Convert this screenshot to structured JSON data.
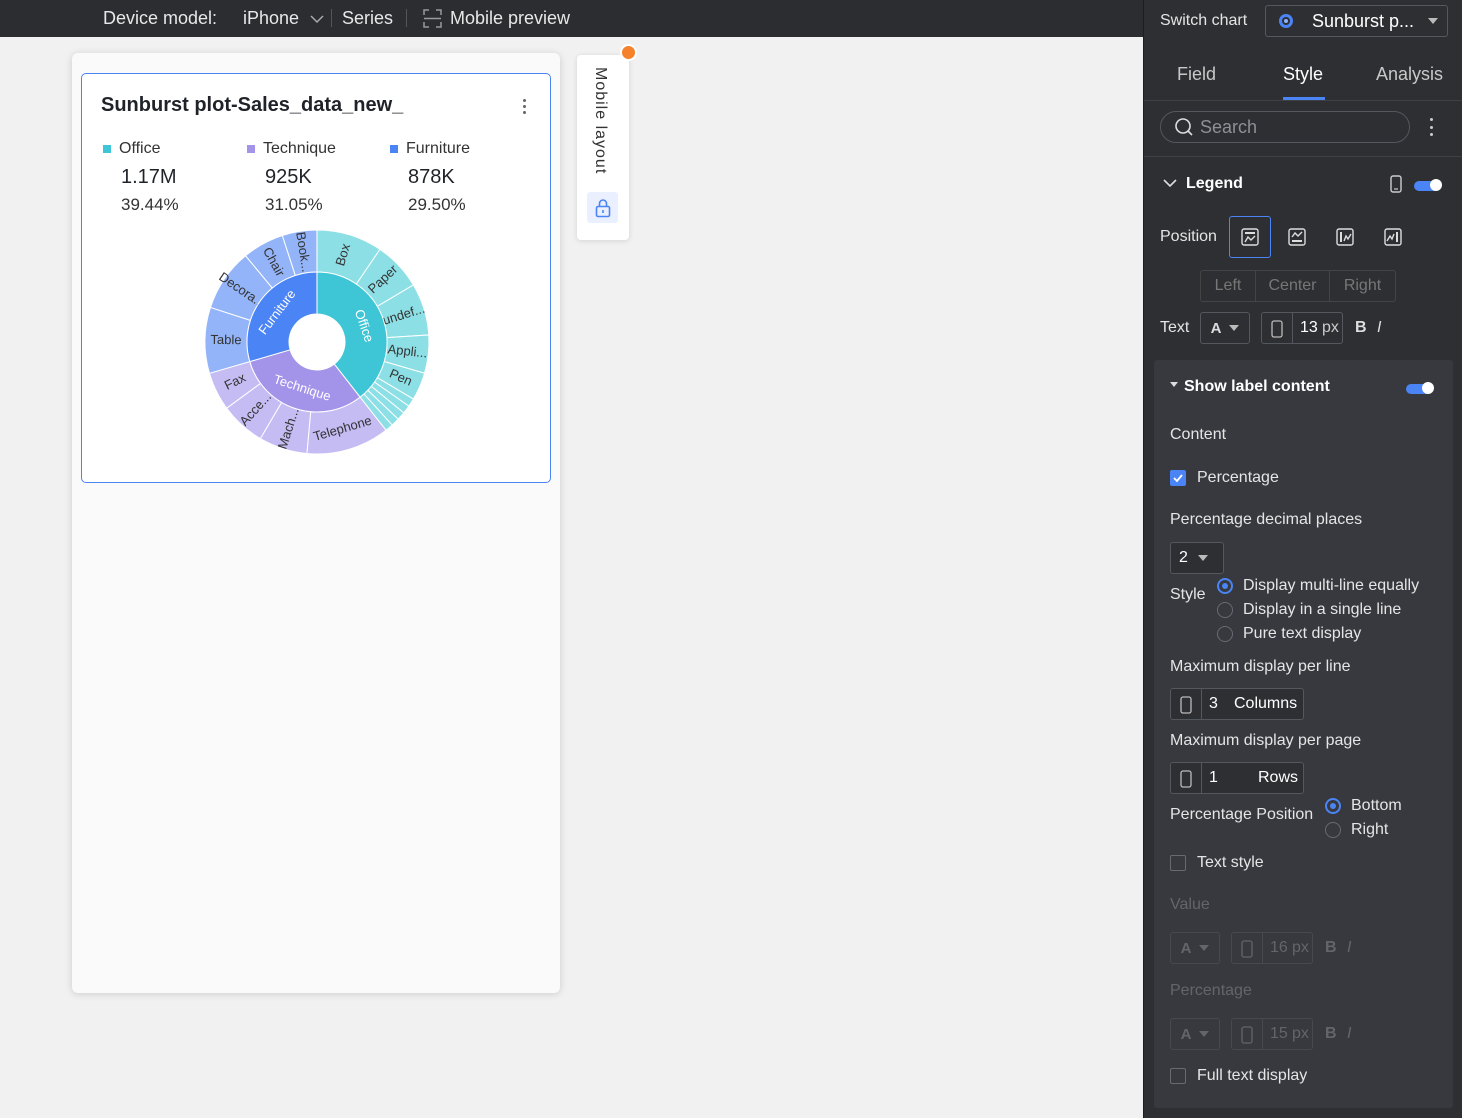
{
  "topbar": {
    "device_label": "Device model:",
    "device_value": "iPhone",
    "series_label": "Series",
    "preview_label": "Mobile preview"
  },
  "card": {
    "title": "Sunburst plot-Sales_data_new_",
    "legend": [
      {
        "name": "Office",
        "value": "1.17M",
        "pct": "39.44%",
        "color": "#3ec6d6"
      },
      {
        "name": "Technique",
        "value": "925K",
        "pct": "31.05%",
        "color": "#a394ea"
      },
      {
        "name": "Furniture",
        "value": "878K",
        "pct": "29.50%",
        "color": "#4a84f5"
      }
    ]
  },
  "chart_data": {
    "type": "sunburst",
    "inner": [
      {
        "name": "Office",
        "share": 0.3944,
        "color": "#3ec6d6"
      },
      {
        "name": "Technique",
        "share": 0.3105,
        "color": "#a394ea"
      },
      {
        "name": "Furniture",
        "share": 0.295,
        "color": "#4a84f5"
      }
    ],
    "outer": [
      {
        "name": "Box",
        "share": 0.095,
        "parent": "Office"
      },
      {
        "name": "Paper",
        "share": 0.07,
        "parent": "Office"
      },
      {
        "name": "undef...",
        "share": 0.075,
        "parent": "Office"
      },
      {
        "name": "Appli...",
        "share": 0.055,
        "parent": "Office"
      },
      {
        "name": "Pen",
        "share": 0.04,
        "parent": "Office"
      },
      {
        "name": "",
        "share": 0.012,
        "parent": "Office"
      },
      {
        "name": "",
        "share": 0.012,
        "parent": "Office"
      },
      {
        "name": "",
        "share": 0.012,
        "parent": "Office"
      },
      {
        "name": "",
        "share": 0.012,
        "parent": "Office"
      },
      {
        "name": "",
        "share": 0.0114,
        "parent": "Office"
      },
      {
        "name": "Telephone",
        "share": 0.12,
        "parent": "Technique"
      },
      {
        "name": "Mach...",
        "share": 0.07,
        "parent": "Technique"
      },
      {
        "name": "Acce...",
        "share": 0.065,
        "parent": "Technique"
      },
      {
        "name": "Fax",
        "share": 0.0555,
        "parent": "Technique"
      },
      {
        "name": "Table",
        "share": 0.095,
        "parent": "Furniture"
      },
      {
        "name": "Decora...",
        "share": 0.09,
        "parent": "Furniture"
      },
      {
        "name": "Chair",
        "share": 0.06,
        "parent": "Furniture"
      },
      {
        "name": "Book...",
        "share": 0.05,
        "parent": "Furniture"
      }
    ]
  },
  "side_tab": {
    "label": "Mobile layout"
  },
  "panel": {
    "switch_label": "Switch chart",
    "chart_type": "Sunburst p...",
    "tabs": [
      "Field",
      "Style",
      "Analysis"
    ],
    "search_placeholder": "Search",
    "legend_label": "Legend",
    "position_label": "Position",
    "align": [
      "Left",
      "Center",
      "Right"
    ],
    "text_label": "Text",
    "font_letter": "A",
    "font_size": "13",
    "unit_px": "px",
    "bold": "B",
    "italic": "I",
    "show_label": "Show label content",
    "content_label": "Content",
    "percentage_check": "Percentage",
    "decimal_label": "Percentage decimal places",
    "decimal_value": "2",
    "style_label": "Style",
    "style_options": [
      "Display multi-line equally",
      "Display in a single line",
      "Pure text display"
    ],
    "max_line_label": "Maximum display per line",
    "max_line_value": "3",
    "max_line_unit": "Columns",
    "max_page_label": "Maximum display per page",
    "max_page_value": "1",
    "max_page_unit": "Rows",
    "pct_pos_label": "Percentage Position",
    "pct_pos_options": [
      "Bottom",
      "Right"
    ],
    "text_style_label": "Text style",
    "value_label": "Value",
    "value_size": "16",
    "percentage_label": "Percentage",
    "percentage_size": "15",
    "full_text_label": "Full text display"
  }
}
